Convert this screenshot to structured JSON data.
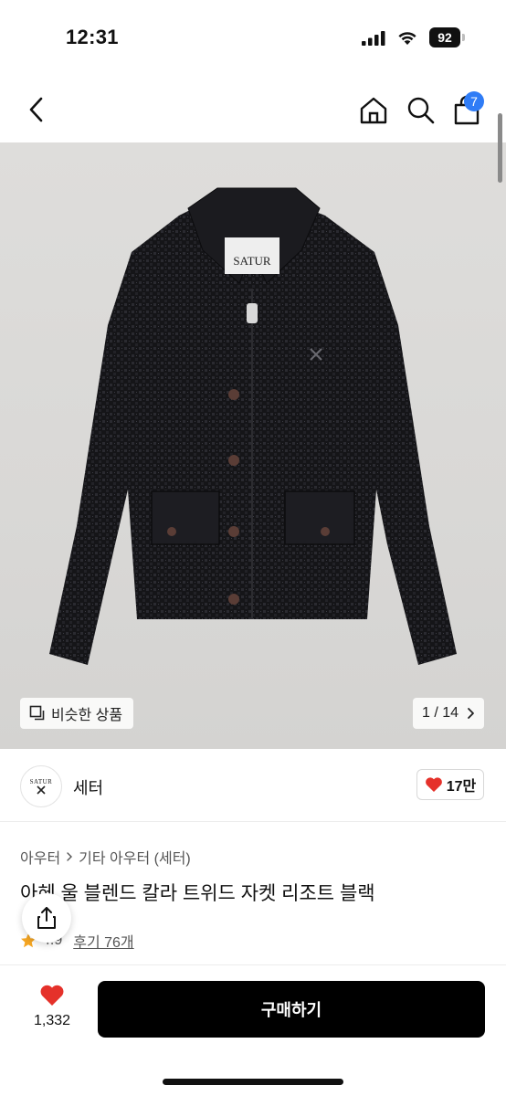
{
  "status_bar": {
    "time": "12:31",
    "battery": "92"
  },
  "nav": {
    "cart_count": "7"
  },
  "image": {
    "label_text": "SATUR",
    "similar_label": "비슷한 상품",
    "counter": "1 / 14"
  },
  "brand": {
    "logo_text": "SATUR",
    "name": "세터",
    "likes": "17만"
  },
  "breadcrumb": {
    "level1": "아우터",
    "level2": "기타 아우터 (세터)"
  },
  "product": {
    "title": "아헤 울 블렌드 칼라 트위드 자켓 리조트 블랙",
    "rating": "4.9",
    "reviews": "후기 76개"
  },
  "bottom": {
    "wish_count": "1,332",
    "buy_label": "구매하기"
  },
  "colors": {
    "accent": "#2f7cf6",
    "heart": "#e5312a",
    "star": "#f5a623",
    "buy_bg": "#000000"
  },
  "icons": [
    "back-icon",
    "home-icon",
    "search-icon",
    "bag-icon",
    "copy-icon",
    "chevron-right-icon",
    "heart-icon",
    "star-icon",
    "share-icon"
  ]
}
